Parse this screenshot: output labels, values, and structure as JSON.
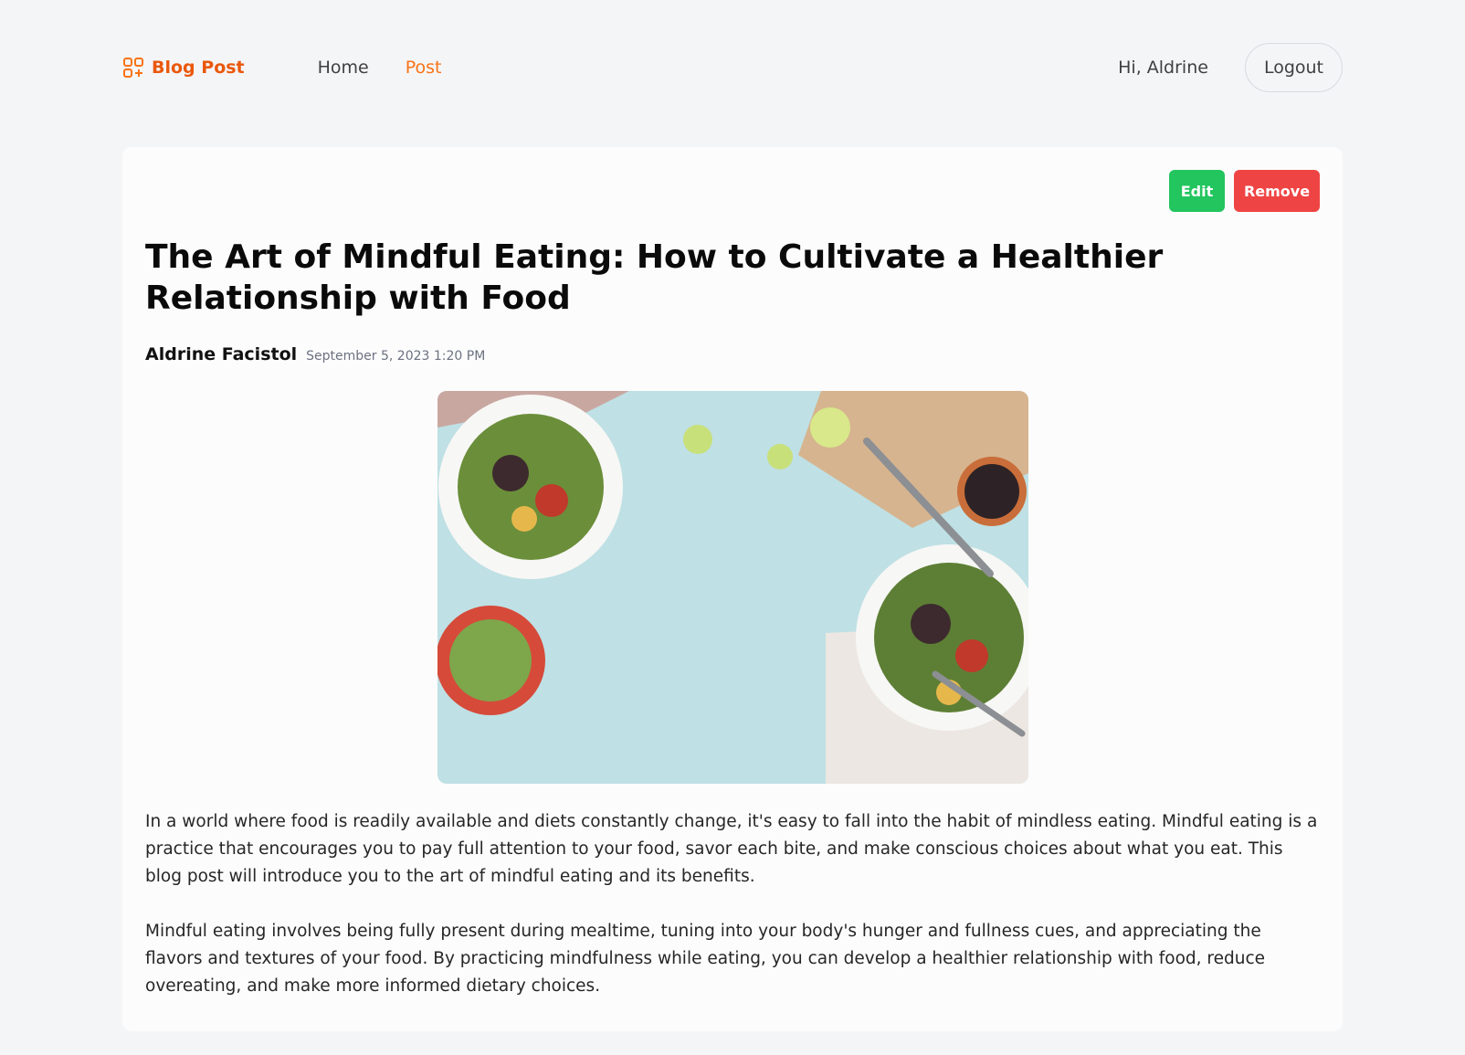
{
  "nav": {
    "brand": "Blog Post",
    "links": [
      "Home",
      "Post"
    ],
    "active": "Post",
    "greeting": "Hi, Aldrine",
    "logout_label": "Logout"
  },
  "post": {
    "edit_label": "Edit",
    "remove_label": "Remove",
    "title": "The Art of Mindful Eating: How to Cultivate a Healthier Relationship with Food",
    "author": "Aldrine Facistol",
    "date": "September 5, 2023 1:20 PM",
    "paragraphs": [
      "In a world where food is readily available and diets constantly change, it's easy to fall into the habit of mindless eating. Mindful eating is a practice that encourages you to pay full attention to your food, savor each bite, and make conscious choices about what you eat. This blog post will introduce you to the art of mindful eating and its benefits.",
      "Mindful eating involves being fully present during mealtime, tuning into your body's hunger and fullness cues, and appreciating the flavors and textures of your food. By practicing mindfulness while eating, you can develop a healthier relationship with food, reduce overeating, and make more informed dietary choices."
    ]
  },
  "colors": {
    "accent": "#f97316",
    "edit": "#22c55e",
    "remove": "#ef4444",
    "background": "#f4f5f7"
  }
}
